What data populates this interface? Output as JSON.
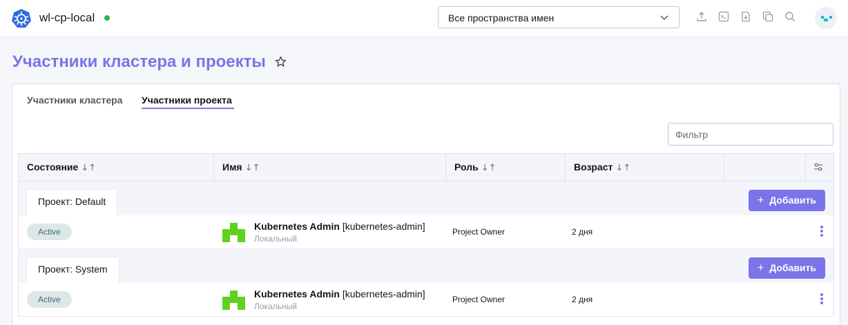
{
  "header": {
    "cluster_name": "wl-cp-local",
    "namespace_select": "Все пространства имен",
    "icons": [
      "upload-icon",
      "terminal-icon",
      "file-download-icon",
      "copy-icon",
      "search-icon"
    ]
  },
  "page": {
    "title": "Участники кластера и проекты"
  },
  "tabs": [
    {
      "label": "Участники кластера",
      "active": false
    },
    {
      "label": "Участники проекта",
      "active": true
    }
  ],
  "filter": {
    "placeholder": "Фильтр"
  },
  "table": {
    "columns": [
      "Состояние",
      "Имя",
      "Роль",
      "Возраст"
    ],
    "sort_glyph": "↓↑",
    "add_label": "Добавить",
    "groups": [
      {
        "label": "Проект: Default",
        "rows": [
          {
            "state": "Active",
            "name": "Kubernetes Admin",
            "login": "[kubernetes-admin]",
            "provider": "Локальный",
            "role": "Project Owner",
            "age": "2 дня"
          }
        ]
      },
      {
        "label": "Проект: System",
        "rows": [
          {
            "state": "Active",
            "name": "Kubernetes Admin",
            "login": "[kubernetes-admin]",
            "provider": "Локальный",
            "role": "Project Owner",
            "age": "2 дня"
          }
        ]
      }
    ]
  },
  "colors": {
    "accent": "#7a74e8",
    "status_dot": "#2ab24f",
    "badge_bg": "#dde7e9",
    "avatar_green": "#5fd21f"
  }
}
